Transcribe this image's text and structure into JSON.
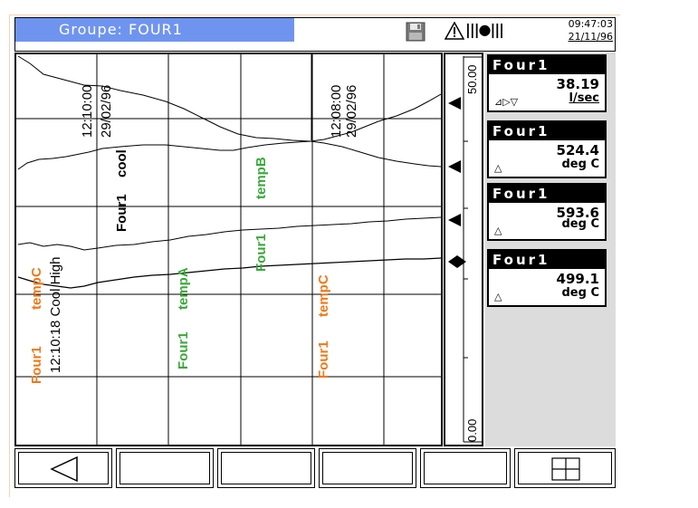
{
  "header": {
    "group_title": "Groupe:  FOUR1",
    "time": "09:47:03",
    "date": "21/11/96",
    "signal_glyph": "|||●|||"
  },
  "icons": {
    "disk": "floppy-disk-icon",
    "warning": "warning-triangle-icon",
    "signal": "signal-bars-icon"
  },
  "chart": {
    "annotations": {
      "cool_time": "12:10:00",
      "cool_date": "29/02/96",
      "cool_label_a": "Four1",
      "cool_label_b": "cool",
      "tempB_label_a": "Four1",
      "tempB_label_b": "tempB",
      "alarm_time_2": "12:08:00",
      "alarm_date_2": "29/02/96",
      "tempC_left_a": "Four1",
      "tempC_left_b": "tempC",
      "alarm_text": "12:10:18  Cool High",
      "tempA_label_a": "Four1",
      "tempA_label_b": "tempA",
      "tempC_right_a": "Four1",
      "tempC_right_b": "tempC"
    },
    "scale_max": "50.00",
    "scale_min": "0.00"
  },
  "panels": [
    {
      "name": "Four1",
      "value": "38.19",
      "unit": "l/sec",
      "symbol": "⊿▷▽"
    },
    {
      "name": "Four1",
      "value": "524.4",
      "unit": "deg  C",
      "symbol": "△"
    },
    {
      "name": "Four1",
      "value": "593.6",
      "unit": "deg  C",
      "symbol": "△"
    },
    {
      "name": "Four1",
      "value": "499.1",
      "unit": "deg  C",
      "symbol": "△"
    }
  ],
  "colors": {
    "title_bg": "#6f94f0",
    "orange": "#f07818",
    "green": "#3aa83a",
    "panel_bg": "#dcdcdc"
  }
}
